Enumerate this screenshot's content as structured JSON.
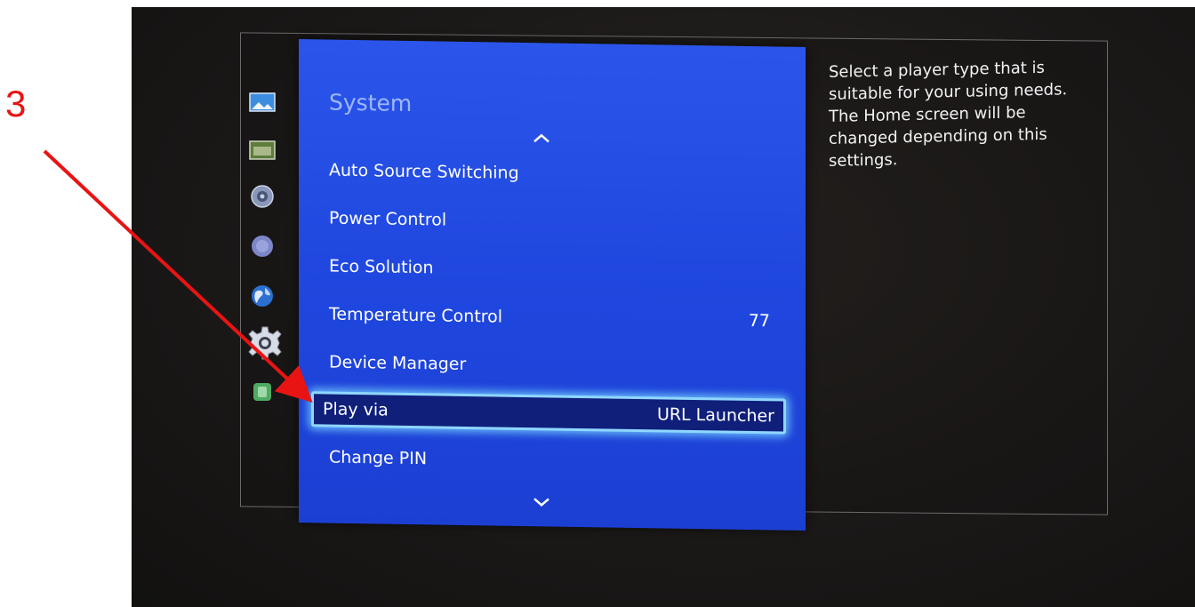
{
  "annotation": {
    "step_number": "3",
    "arrow_color": "#e81414"
  },
  "sidebar": {
    "icons": [
      {
        "name": "picture-icon"
      },
      {
        "name": "screen-icon"
      },
      {
        "name": "sound-icon"
      },
      {
        "name": "broadcast-icon"
      },
      {
        "name": "network-icon"
      },
      {
        "name": "system-gear-icon",
        "active": true
      },
      {
        "name": "support-icon"
      }
    ]
  },
  "menu": {
    "title": "System",
    "items": [
      {
        "label": "Auto Source Switching",
        "value": ""
      },
      {
        "label": "Power Control",
        "value": ""
      },
      {
        "label": "Eco Solution",
        "value": ""
      },
      {
        "label": "Temperature Control",
        "value": "77"
      },
      {
        "label": "Device Manager",
        "value": ""
      },
      {
        "label": "Play via",
        "value": "URL Launcher",
        "selected": true
      },
      {
        "label": "Change PIN",
        "value": ""
      }
    ]
  },
  "help": {
    "text": "Select a player type that is suitable for your using needs. The Home screen will be changed depending on this settings."
  },
  "colors": {
    "menu_blue": "#2349e4",
    "selection_glow": "#8fd6ff",
    "selection_fill": "#0f1f7a"
  }
}
